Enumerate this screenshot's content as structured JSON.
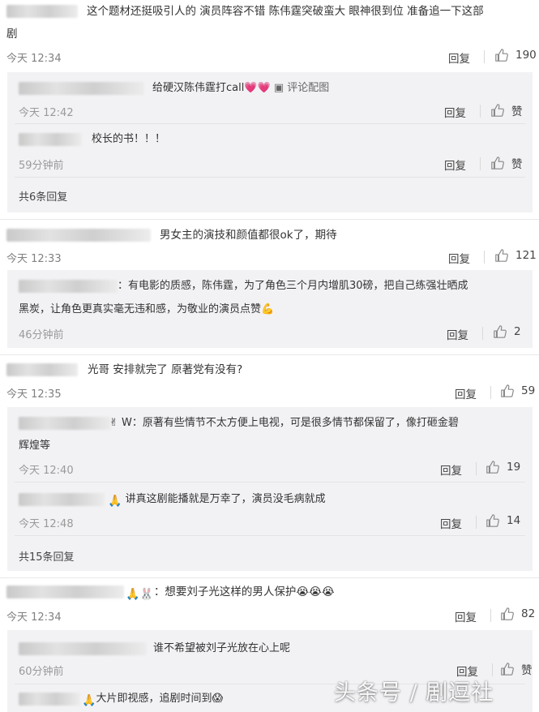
{
  "labels": {
    "reply": "回复",
    "like": "赞"
  },
  "comments": [
    {
      "text": "这个题材还挺吸引人的 演员阵容不错 陈伟霆突破蛮大 眼神很到位 准备追一下这部",
      "text2": "剧",
      "time": "今天 12:34",
      "likes": "190",
      "replies": [
        {
          "text": "给硬汉陈伟霆打call💗💗",
          "pic_label": "评论配图",
          "time": "今天 12:42",
          "likes": "赞"
        },
        {
          "text": "校长的书！！！",
          "time": "59分钟前",
          "likes": "赞"
        }
      ],
      "more": "共6条回复"
    },
    {
      "text": "男女主的演技和颜值都很ok了，期待",
      "time": "今天 12:33",
      "likes": "121",
      "replies": [
        {
          "text": "：有电影的质感，陈伟霆，为了角色三个月内增肌30磅，把自己练强壮晒成",
          "text2": "黑炭，让角色更真实毫无违和感，为敬业的演员点赞💪",
          "time": "46分钟前",
          "likes": "2"
        }
      ]
    },
    {
      "text": "光哥 安排就完了 原著党有没有?",
      "time": "今天 12:35",
      "likes": "59",
      "replies": [
        {
          "text": "✌ W：原著有些情节不太方便上电视，可是很多情节都保留了，像打砸金碧",
          "text2": "辉煌等",
          "time": "今天 12:40",
          "likes": "19"
        },
        {
          "text": "讲真这剧能播就是万幸了，演员没毛病就成",
          "time": "今天 12:48",
          "likes": "14"
        }
      ],
      "more": "共15条回复"
    },
    {
      "text": "：想要刘子光这样的男人保护😭😭😭",
      "time": "今天 12:34",
      "likes": "82",
      "replies": [
        {
          "text": "谁不希望被刘子光放在心上呢",
          "time": "60分钟前",
          "likes": "赞"
        },
        {
          "text": "大片即视感，追剧时间到😱"
        }
      ]
    }
  ],
  "watermark": "头条号 / 剧逗社"
}
